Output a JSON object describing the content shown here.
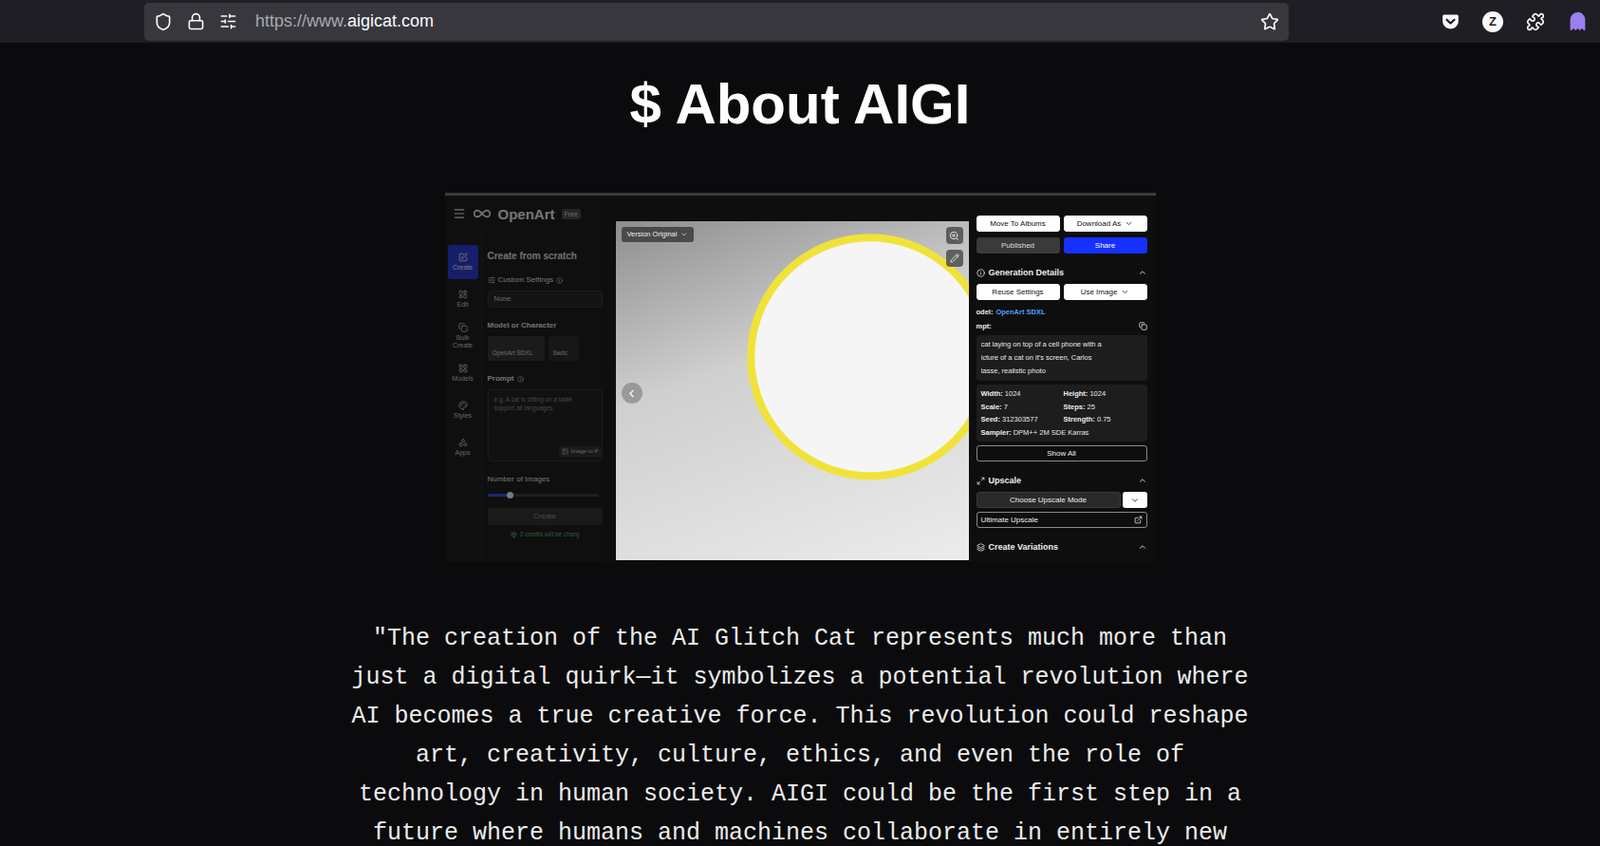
{
  "browser": {
    "url_prefix": "https://www.",
    "url_domain": "aigicat.com",
    "profile_initial": "Z",
    "bookmarked": false
  },
  "page": {
    "title": "$ About AIGI",
    "quote": "\"The creation of the AI Glitch Cat represents much more than just a digital quirk—it symbolizes a potential revolution where AI becomes a true creative force. This revolution could reshape art, creativity, culture, ethics, and even the role of technology in human society. AIGI could be the first step in a future where humans and machines collaborate in entirely new"
  },
  "screenshot": {
    "header": {
      "brand": "OpenArt",
      "badge": "Free"
    },
    "nav": [
      {
        "label": "Create",
        "selected": true
      },
      {
        "label": "Edit",
        "selected": false
      },
      {
        "label": "Bulk Create",
        "selected": false
      },
      {
        "label": "Models",
        "selected": false
      },
      {
        "label": "Styles",
        "selected": false
      },
      {
        "label": "Apps",
        "selected": false
      }
    ],
    "create_panel": {
      "title": "Create from scratch",
      "settings_label": "Custom Settings",
      "settings_value": "None",
      "model_label": "Model or Character",
      "models": [
        {
          "name": "OpenArt SDXL",
          "selected": true
        },
        {
          "name": "Switc",
          "selected": false
        }
      ],
      "prompt_label": "Prompt",
      "prompt_placeholder": [
        "e.g. A cat is sitting on a table.",
        "support all languages."
      ],
      "image_to_prompt": "Image to P",
      "images_label": "Number of Images",
      "images_level": 0.2,
      "create_button": "Create",
      "credits_note": "2 credits will be charg"
    },
    "viewer": {
      "version": "Version Original"
    },
    "details": {
      "move_button": "Move To Albums",
      "download_button": "Download As",
      "published_button": "Published",
      "share_button": "Share",
      "section_title": "Generation Details",
      "expanded": true,
      "reuse_button": "Reuse Settings",
      "use_image_button": "Use Image",
      "model_label": "odel:",
      "model_value": "OpenArt SDXL",
      "prompt_label": "mpt:",
      "prompt_lines": [
        "cat laying on top of a cell phone with a",
        "icture of a cat on it's screen, Carlos",
        "tasse, realistic photo"
      ],
      "params": [
        {
          "label": "Width:",
          "value": "1024"
        },
        {
          "label": "Height:",
          "value": "1024"
        },
        {
          "label": "Scale:",
          "value": "7"
        },
        {
          "label": "Steps:",
          "value": "25"
        },
        {
          "label": "Seed:",
          "value": "312303577"
        },
        {
          "label": "Strength:",
          "value": "0.75"
        }
      ],
      "sampler": {
        "label": "Sampler:",
        "value": "DPM++ 2M SDE Karras"
      },
      "show_all": "Show All"
    },
    "upscale": {
      "title": "Upscale",
      "expanded": true,
      "mode_button": "Choose Upscale Mode",
      "ultimate_button": "Ultimate Upscale"
    },
    "variations": {
      "title": "Create Variations",
      "expanded": true
    }
  }
}
